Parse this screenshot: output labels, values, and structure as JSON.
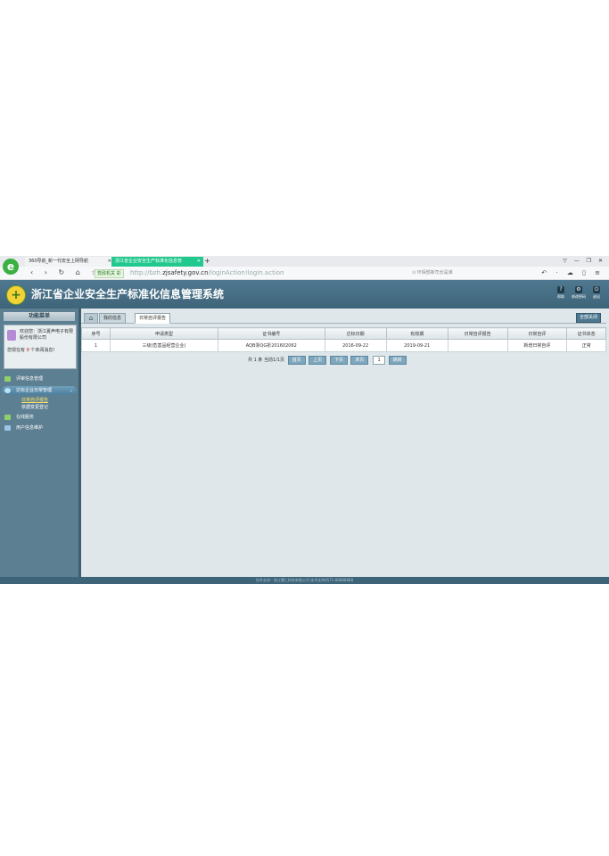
{
  "browser": {
    "tabs": [
      {
        "label": "360导航_新一代安全上网导航",
        "active": false
      },
      {
        "label": "浙江省企业安全生产标准化信息管",
        "active": true
      }
    ],
    "new_tab": "+",
    "window_controls": "▽ — ❐ ✕",
    "nav_icons": "‹ › ↻ ⌂ ☆",
    "security_badge": "党政机关 彩",
    "url_prefix": "http://bzh.",
    "url_domain": "zjsafety.gov.cn",
    "url_path": "/loginAction!login.action",
    "search_placeholder": "环保部新司长是谁",
    "right_tools": "↶ · ☁ ▯ ≡"
  },
  "app": {
    "title": "浙江省企业安全生产标准化信息管理系统",
    "header_buttons": [
      {
        "icon": "help-icon",
        "glyph": "?",
        "label": "帮助"
      },
      {
        "icon": "gear-icon",
        "glyph": "⚙",
        "label": "修改密码"
      },
      {
        "icon": "power-icon",
        "glyph": "⏻",
        "label": "退出"
      }
    ]
  },
  "sidebar": {
    "title": "功能菜单",
    "welcome": "欢迎您：浙江夏声电子有限股份有限公司",
    "messages_prefix": "您现在有",
    "messages_count": "0",
    "messages_suffix": "个未阅消息！",
    "menu": [
      {
        "label": "评审信息管理",
        "active": false
      },
      {
        "label": "达标企业日常管理",
        "active": true
      },
      {
        "label": "在线服务",
        "active": false
      },
      {
        "label": "用户信息维护",
        "active": false
      }
    ],
    "submenu": [
      {
        "label": "日常自评报告",
        "selected": true
      },
      {
        "label": "依据变更登记",
        "selected": false
      }
    ]
  },
  "content": {
    "tabs": [
      {
        "label": "我的信息",
        "current": false
      },
      {
        "label": "日常自评报告",
        "current": true
      }
    ],
    "close_all": "全部关闭",
    "table": {
      "columns": [
        "序号",
        "申请类型",
        "证书编号",
        "达标日期",
        "有效期",
        "日常自评报告",
        "日常自评",
        "证书状态"
      ],
      "rows": [
        [
          "1",
          "三级(危害品经营企业)",
          "AQB浙QG折201602062",
          "2016-09-22",
          "2019-09-21",
          "",
          "新增日常自评",
          "正常"
        ]
      ]
    },
    "pager": {
      "summary": "共 1 条  当前1/1页",
      "first": "首页",
      "prev": "上页",
      "next": "下页",
      "last": "末页",
      "page_input": "1",
      "go": "跳转"
    }
  },
  "footer": {
    "text": "技术支持：浙江慧仁科技有限公司 技术支持0571-88888888"
  }
}
